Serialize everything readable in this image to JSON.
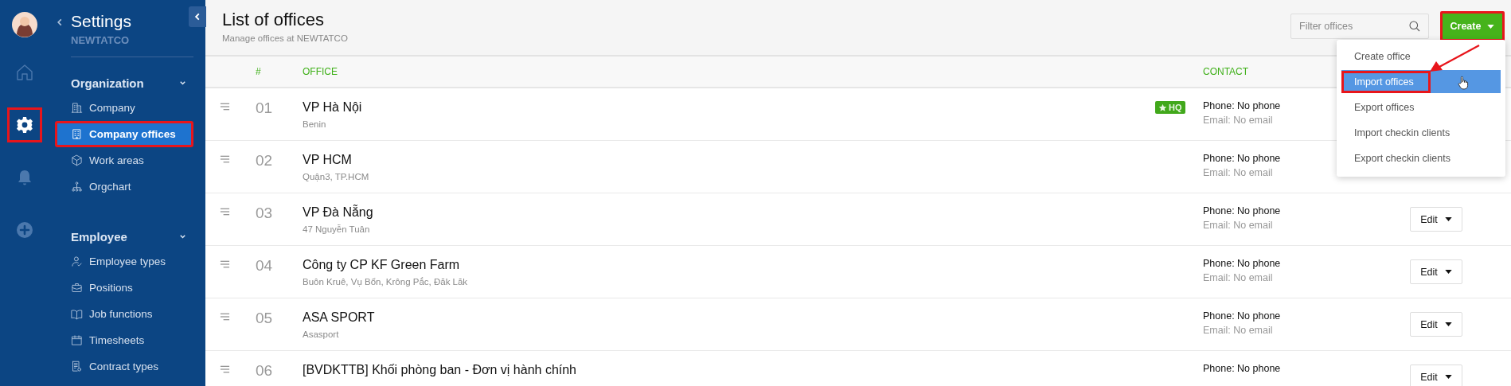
{
  "rail": {
    "items": [
      {
        "kind": "avatar"
      },
      {
        "kind": "home",
        "selected": false,
        "highlighted": false
      },
      {
        "kind": "settings",
        "selected": true,
        "highlighted": true
      },
      {
        "kind": "bell",
        "selected": false,
        "highlighted": false
      },
      {
        "kind": "add",
        "selected": false,
        "highlighted": false
      }
    ]
  },
  "sidebar": {
    "title": "Settings",
    "subtitle": "NEWTATCO",
    "sections": [
      {
        "title": "Organization",
        "expanded": true,
        "items": [
          {
            "label": "Company",
            "kind": "building",
            "selected": false,
            "highlighted": false
          },
          {
            "label": "Company offices",
            "kind": "office",
            "selected": true,
            "highlighted": true
          },
          {
            "label": "Work areas",
            "kind": "cube",
            "selected": false,
            "highlighted": false
          },
          {
            "label": "Orgchart",
            "kind": "orgchart",
            "selected": false,
            "highlighted": false
          }
        ]
      },
      {
        "title": "Employee",
        "expanded": true,
        "items": [
          {
            "label": "Employee types",
            "kind": "person",
            "selected": false,
            "highlighted": false
          },
          {
            "label": "Positions",
            "kind": "briefcase",
            "selected": false,
            "highlighted": false
          },
          {
            "label": "Job functions",
            "kind": "book",
            "selected": false,
            "highlighted": false
          },
          {
            "label": "Timesheets",
            "kind": "calendar",
            "selected": false,
            "highlighted": false
          },
          {
            "label": "Contract types",
            "kind": "contract",
            "selected": false,
            "highlighted": false
          }
        ]
      }
    ]
  },
  "header": {
    "title": "List of offices",
    "subtitle": "Manage offices at NEWTATCO"
  },
  "filter": {
    "placeholder": "Filter offices"
  },
  "create_button": {
    "label": "Create",
    "highlighted": true
  },
  "menu": {
    "items": [
      {
        "label": "Create office",
        "selected": false,
        "highlighted": false
      },
      {
        "label": "Import offices",
        "selected": true,
        "highlighted": true
      },
      {
        "label": "Export offices",
        "selected": false,
        "highlighted": false
      },
      {
        "label": "Import checkin clients",
        "selected": false,
        "highlighted": false
      },
      {
        "label": "Export checkin clients",
        "selected": false,
        "highlighted": false
      }
    ]
  },
  "annotation_arrow": true,
  "table": {
    "columns": [
      "#",
      "OFFICE",
      "CONTACT"
    ],
    "rows": [
      {
        "number": "01",
        "name": "VP Hà Nội",
        "address": "Benin",
        "hq": true,
        "badge": "HQ",
        "phone": "Phone: No phone",
        "email": "Email: No email"
      },
      {
        "number": "02",
        "name": "VP HCM",
        "address": "Quận3, TP.HCM",
        "hq": false,
        "phone": "Phone: No phone",
        "email": "Email: No email"
      },
      {
        "number": "03",
        "name": "VP Đà Nẵng",
        "address": "47 Nguyễn Tuân",
        "hq": false,
        "phone": "Phone: No phone",
        "email": "Email: No email",
        "action": "Edit"
      },
      {
        "number": "04",
        "name": "Công ty CP KF Green Farm",
        "address": "Buôn Kruê, Vụ Bổn, Krông Pắc, Đăk Lăk",
        "hq": false,
        "phone": "Phone: No phone",
        "email": "Email: No email",
        "action": "Edit"
      },
      {
        "number": "05",
        "name": "ASA SPORT",
        "address": "Asasport",
        "hq": false,
        "phone": "Phone: No phone",
        "email": "Email: No email",
        "action": "Edit"
      },
      {
        "number": "06",
        "name": "[BVDKTTB] Khối phòng ban - Đơn vị hành chính",
        "hq": false,
        "phone": "Phone: No phone",
        "action": "Edit"
      }
    ]
  }
}
